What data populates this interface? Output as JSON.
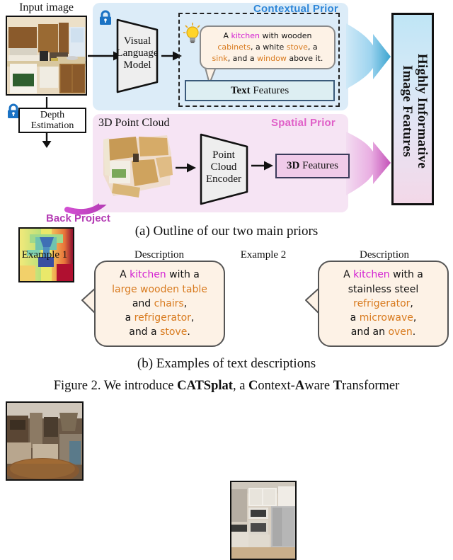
{
  "figure": {
    "caption_a": "(a) Outline of our two main priors",
    "caption_b": "(b) Examples of text descriptions",
    "caption_figure": "Figure 2.  We introduce CATSplat, a Context-Aware Transformer"
  },
  "pipeline": {
    "input_image_label": "Input image",
    "vlm_block": "Visual\nLanguage\nModel",
    "vlm_line1": "Visual",
    "vlm_line2": "Language",
    "vlm_line3": "Model",
    "depth_estimation_label": "Depth\nEstimation",
    "depth_line1": "Depth",
    "depth_line2": "Estimation",
    "back_project_label": "Back Project",
    "point_cloud_label": "3D Point Cloud",
    "encoder_line1": "Point",
    "encoder_line2": "Cloud",
    "encoder_line3": "Encoder",
    "lock_icon_name": "frozen-lock-icon"
  },
  "contextual_prior": {
    "title": "Contextual Prior",
    "title_color": "#2e86d8",
    "panel_color": "#dcecf8",
    "bubble_line1": [
      {
        "t": "A ",
        "c": "plain"
      },
      {
        "t": "kitchen",
        "c": "scene"
      },
      {
        "t": " with wooden",
        "c": "plain"
      }
    ],
    "bubble_line2": [
      {
        "t": "cabinets",
        "c": "obj"
      },
      {
        "t": ", a white ",
        "c": "plain"
      },
      {
        "t": "stove",
        "c": "obj"
      },
      {
        "t": ", a",
        "c": "plain"
      }
    ],
    "bubble_line3": [
      {
        "t": "sink",
        "c": "obj"
      },
      {
        "t": ", and a ",
        "c": "plain"
      },
      {
        "t": "window",
        "c": "obj"
      },
      {
        "t": " above it.",
        "c": "plain"
      }
    ],
    "text_features_bold": "Text",
    "text_features_rest": " Features"
  },
  "spatial_prior": {
    "title": "Spatial Prior",
    "title_color": "#e060c8",
    "panel_color": "#f6e4f4",
    "features_bold": "3D",
    "features_rest": " Features"
  },
  "output": {
    "line1": "Highly Informative",
    "line2": "Image Features",
    "gradient_top": "#bfe5f5",
    "gradient_bottom": "#f3d8e8"
  },
  "examples": [
    {
      "title": "Example 1",
      "description_title": "Description",
      "lines": [
        [
          {
            "t": "A ",
            "c": "plain"
          },
          {
            "t": "kitchen",
            "c": "scene"
          },
          {
            "t": " with a",
            "c": "plain"
          }
        ],
        [
          {
            "t": "large wooden table",
            "c": "obj"
          }
        ],
        [
          {
            "t": "and ",
            "c": "plain"
          },
          {
            "t": "chairs",
            "c": "obj"
          },
          {
            "t": ",",
            "c": "plain"
          }
        ],
        [
          {
            "t": "a ",
            "c": "plain"
          },
          {
            "t": "refrigerator",
            "c": "obj"
          },
          {
            "t": ",",
            "c": "plain"
          }
        ],
        [
          {
            "t": "and a ",
            "c": "plain"
          },
          {
            "t": "stove",
            "c": "obj"
          },
          {
            "t": ".",
            "c": "plain"
          }
        ]
      ]
    },
    {
      "title": "Example 2",
      "description_title": "Description",
      "lines": [
        [
          {
            "t": "A ",
            "c": "plain"
          },
          {
            "t": "kitchen",
            "c": "scene"
          },
          {
            "t": " with a",
            "c": "plain"
          }
        ],
        [
          {
            "t": "stainless steel",
            "c": "plain"
          }
        ],
        [
          {
            "t": "refrigerator",
            "c": "obj"
          },
          {
            "t": ",",
            "c": "plain"
          }
        ],
        [
          {
            "t": "a ",
            "c": "plain"
          },
          {
            "t": "microwave",
            "c": "obj"
          },
          {
            "t": ",",
            "c": "plain"
          }
        ],
        [
          {
            "t": "and an ",
            "c": "plain"
          },
          {
            "t": "oven",
            "c": "obj"
          },
          {
            "t": ".",
            "c": "plain"
          }
        ]
      ]
    }
  ],
  "colors": {
    "object_word": "#d87a1e",
    "scene_word": "#d21fd2",
    "lock_blue": "#1a72c4",
    "back_project_purple": "#b43cb4"
  }
}
